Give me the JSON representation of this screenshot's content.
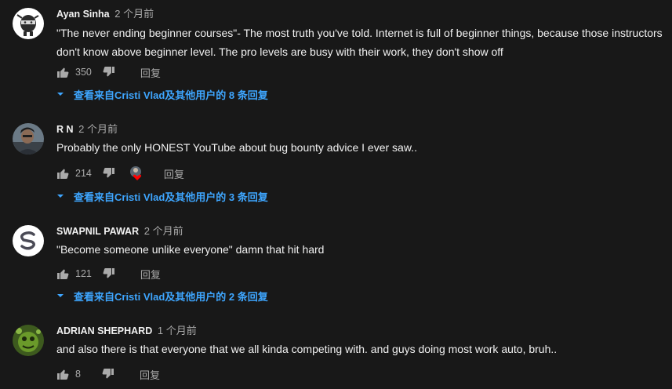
{
  "comments": [
    {
      "author": "Ayan Sinha",
      "time": "2 个月前",
      "text": "\"The never ending beginner courses\"- The most truth you've told. Internet is full of beginner things, because those instructors don't know above beginner level. The pro levels are busy with their work, they don't show off",
      "likes": "350",
      "reply_label": "回复",
      "view_replies": "查看来自Cristi Vlad及其他用户的 8 条回复",
      "avatar_icon": "ninja-avatar"
    },
    {
      "author": "R N",
      "time": "2 个月前",
      "text": "Probably the only HONEST YouTube about bug bounty advice I ever saw..",
      "likes": "214",
      "reply_label": "回复",
      "view_replies": "查看来自Cristi Vlad及其他用户的 3 条回复",
      "avatar_icon": "person-photo-avatar",
      "creator_heart": "creator-heart-icon"
    },
    {
      "author": "SWAPNIL PAWAR",
      "time": "2 个月前",
      "text": "\"Become someone unlike everyone\"  damn that hit hard",
      "likes": "121",
      "reply_label": "回复",
      "view_replies": "查看来自Cristi Vlad及其他用户的 2 条回复",
      "avatar_icon": "sp-logo-avatar"
    },
    {
      "author": "ADRIAN SHEPHARD",
      "time": "1 个月前",
      "text": "and also there is that everyone that we all kinda competing with. and guys doing most work auto, bruh..",
      "likes": "8",
      "reply_label": "回复",
      "avatar_icon": "green-creature-avatar"
    }
  ],
  "colors": {
    "background": "#181818",
    "link": "#3ea6ff",
    "secondary_text": "#aaaaaa",
    "heart": "#ff0000"
  }
}
